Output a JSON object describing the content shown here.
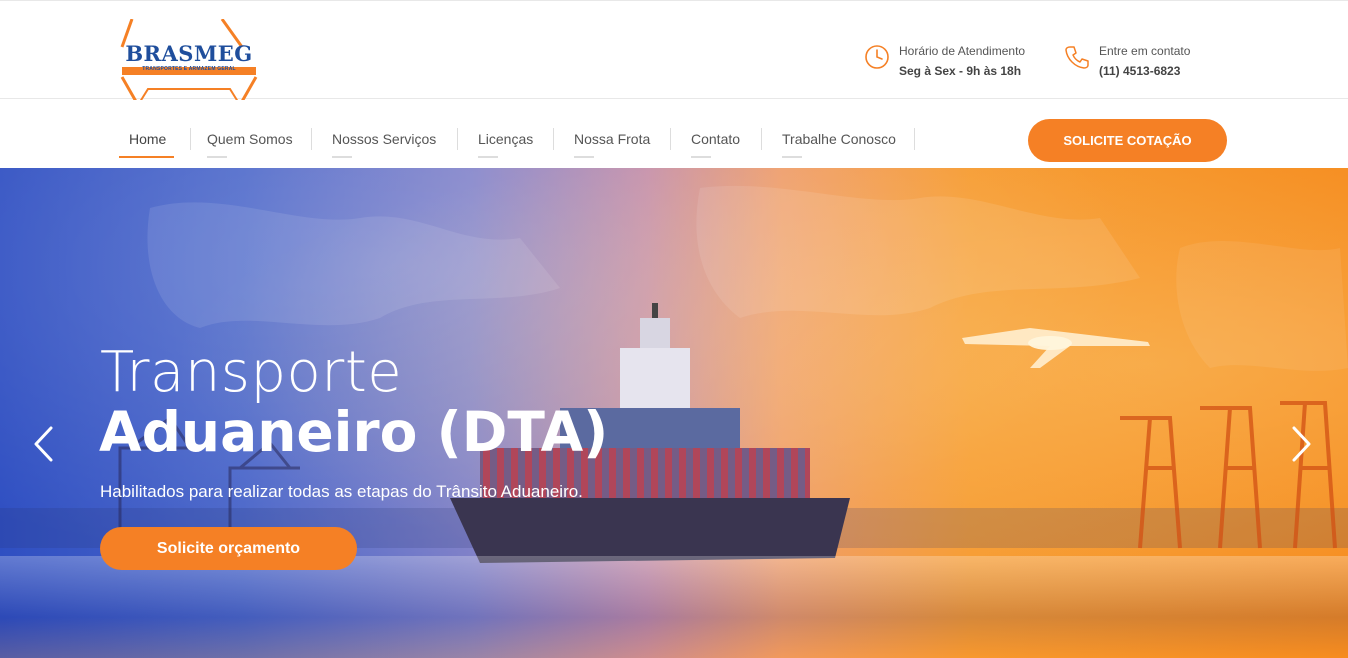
{
  "brand": {
    "name": "BRASMEG",
    "tagline": "TRANSPORTES E ARMAZÉM GERAL",
    "blue": "#1f4e9c",
    "orange": "#f58025"
  },
  "header": {
    "hours": {
      "icon": "clock-icon",
      "label": "Horário de Atendimento",
      "value": "Seg à Sex - 9h às 18h"
    },
    "contact": {
      "icon": "phone-icon",
      "label": "Entre em contato",
      "value": "(11) 4513-6823"
    }
  },
  "nav": {
    "items": [
      {
        "label": "Home",
        "active": true
      },
      {
        "label": "Quem Somos",
        "active": false
      },
      {
        "label": "Nossos Serviços",
        "active": false
      },
      {
        "label": "Licenças",
        "active": false
      },
      {
        "label": "Nossa Frota",
        "active": false
      },
      {
        "label": "Contato",
        "active": false
      },
      {
        "label": "Trabalhe Conosco",
        "active": false
      }
    ],
    "cta_label": "SOLICITE COTAÇÃO"
  },
  "hero": {
    "title_line1": "Transporte",
    "title_line2": "Aduaneiro (DTA)",
    "subtitle": "Habilitados para realizar todas as etapas do Trânsito Aduaneiro.",
    "button_label": "Solicite orçamento",
    "prev_icon": "chevron-left-icon",
    "next_icon": "chevron-right-icon"
  }
}
